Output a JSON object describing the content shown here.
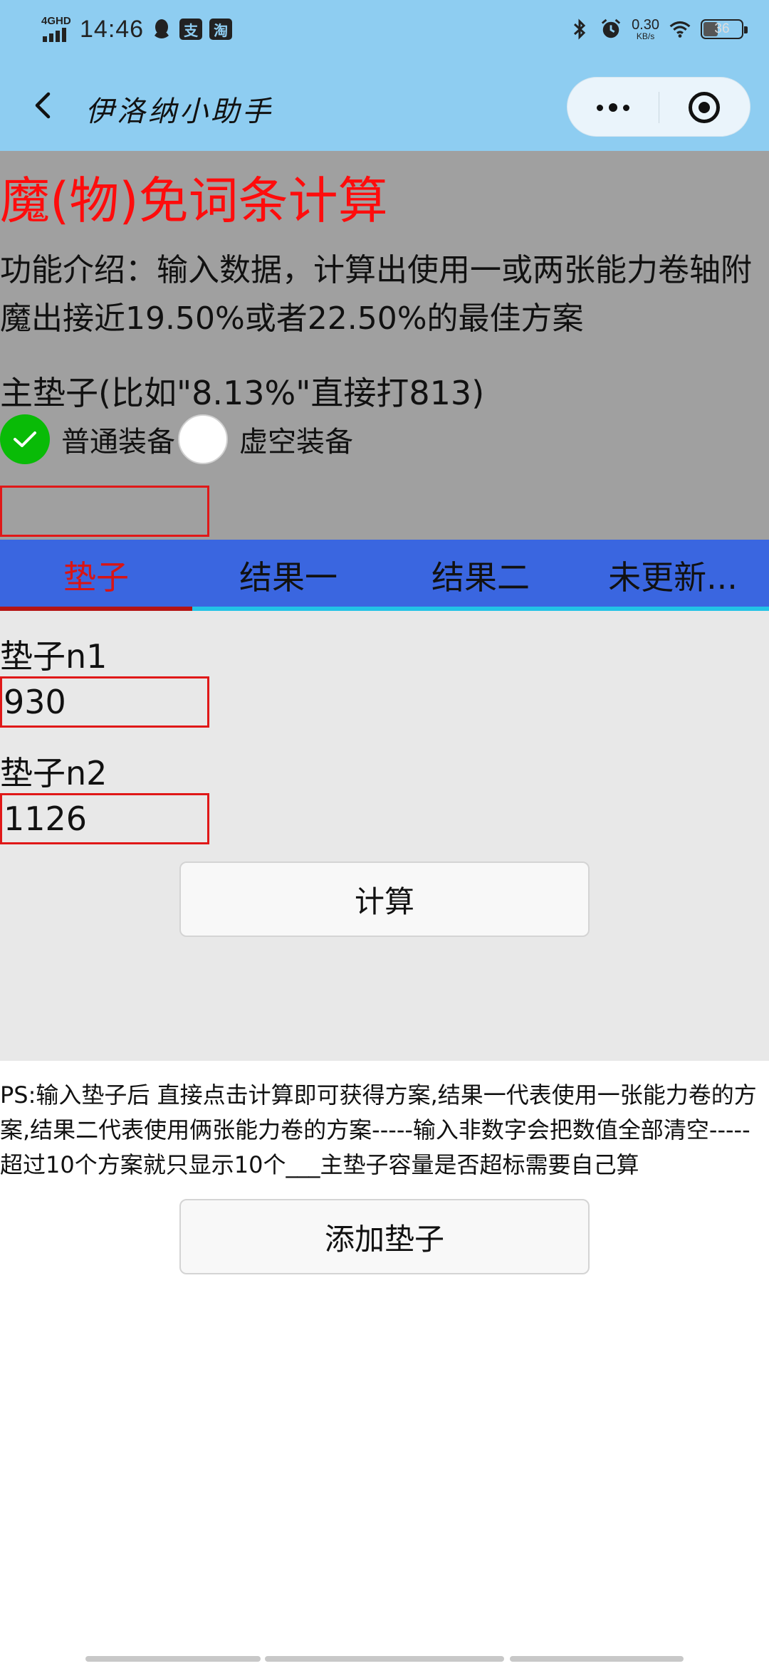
{
  "status_bar": {
    "network": "4GHD",
    "time": "14:46",
    "app_icon_1": "支",
    "app_icon_2": "淘",
    "speed_value": "0.30",
    "speed_unit": "KB/s",
    "battery": "36",
    "battery_level": 0.36
  },
  "nav": {
    "title": "伊洛纳小助手"
  },
  "intro": {
    "page_title": "魔(物)免词条计算",
    "description": "功能介绍：输入数据，计算出使用一或两张能力卷轴附魔出接近19.50%或者22.50%的最佳方案",
    "main_pad_label": "主垫子(比如\"8.13%\"直接打813)",
    "radio_normal": "普通装备",
    "radio_void": "虚空装备",
    "radio_selected": "普通装备",
    "main_pad_value": ""
  },
  "tabs": [
    {
      "label": "垫子",
      "active": true
    },
    {
      "label": "结果一",
      "active": false
    },
    {
      "label": "结果二",
      "active": false
    },
    {
      "label": "未更新...",
      "active": false
    }
  ],
  "pads": [
    {
      "label": "垫子n1",
      "value": "930"
    },
    {
      "label": "垫子n2",
      "value": "1126"
    }
  ],
  "calc_button": "计算",
  "ps_note": "PS:输入垫子后 直接点击计算即可获得方案,结果一代表使用一张能力卷的方案,结果二代表使用俩张能力卷的方案-----输入非数字会把数值全部清空-----超过10个方案就只显示10个___主垫子容量是否超标需要自己算",
  "add_button": "添加垫子",
  "colors": {
    "status_bg": "#8ecdf1",
    "intro_bg": "#a0a0a0",
    "title_red": "#ff0c0c",
    "tab_bg": "#3a66e0",
    "tab_active": "#d81515",
    "tab_underline": "#22c3e6",
    "radio_green": "#09bb07",
    "input_border": "#e01818",
    "panel_bg": "#e8e8e8"
  }
}
